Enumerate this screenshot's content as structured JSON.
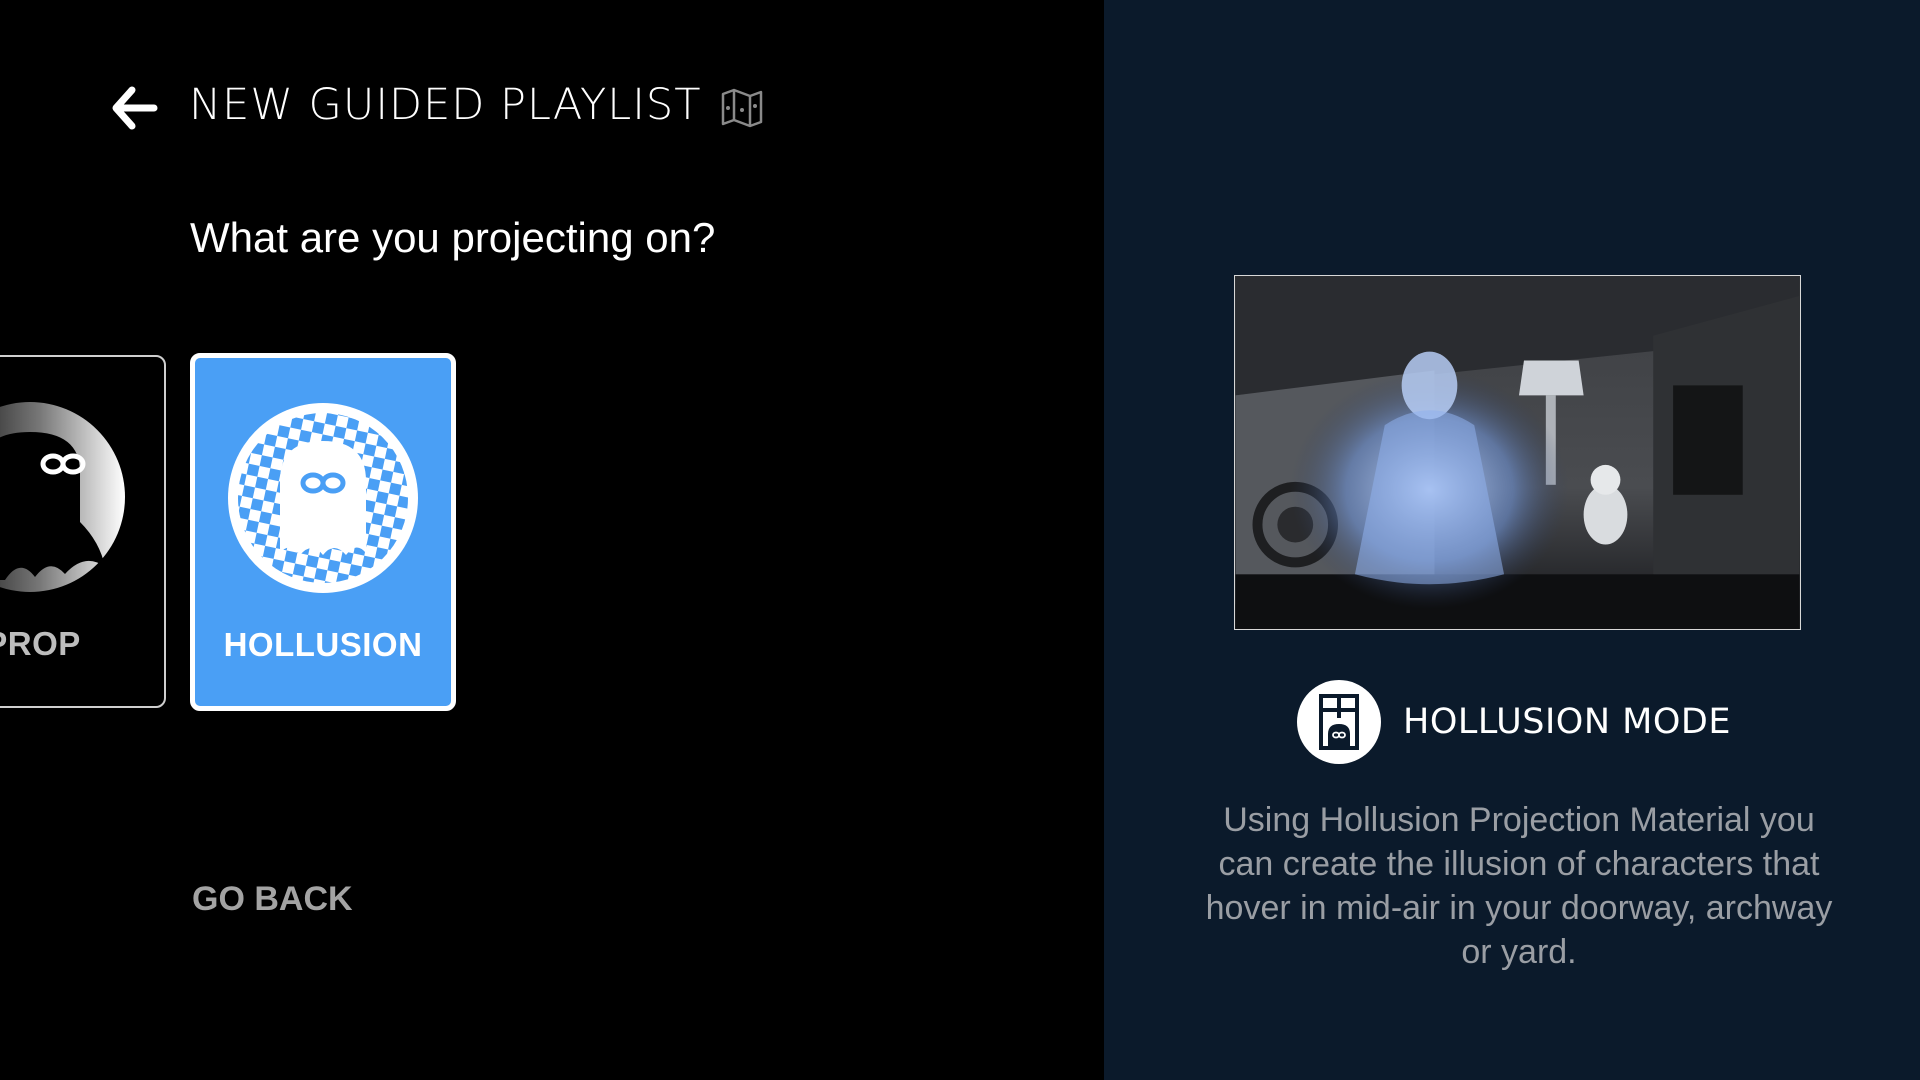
{
  "header": {
    "title": "NEW GUIDED PLAYLIST",
    "back_icon": "arrow-left-icon",
    "guide_icon": "map-icon"
  },
  "main": {
    "question": "What are you projecting on?",
    "cards": [
      {
        "label": "PROP",
        "icon": "ghost-circle-icon",
        "selected": false
      },
      {
        "label": "HOLLUSION",
        "icon": "ghost-checkered-circle-icon",
        "selected": true
      }
    ],
    "go_back_label": "GO BACK"
  },
  "detail": {
    "mode_icon": "window-ghost-icon",
    "mode_title": "HOLLUSION MODE",
    "description": "Using Hollusion Projection Material you can create the illusion of characters that hover in mid-air in your doorway, archway or yard."
  },
  "colors": {
    "left_background": "#000000",
    "right_background": "#0b1a2b",
    "selected_card": "#4a9ff5",
    "text_primary": "#ffffff",
    "text_muted": "#9a9ea4"
  }
}
